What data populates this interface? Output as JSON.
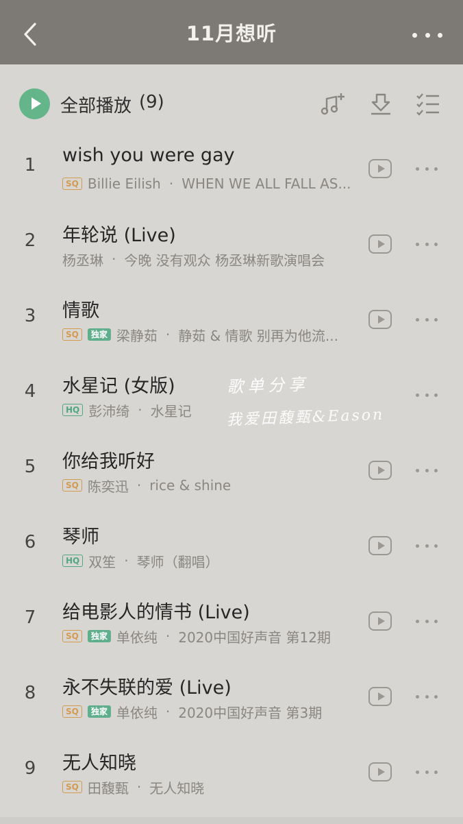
{
  "header": {
    "title": "11月想听"
  },
  "play_all": {
    "label": "全部播放",
    "count": "(9)"
  },
  "songs": [
    {
      "index": "1",
      "title": "wish you were gay",
      "badges": [
        "SQ"
      ],
      "artist": "Billie Eilish",
      "album": "WHEN WE ALL FALL AS...",
      "video": true
    },
    {
      "index": "2",
      "title": "年轮说 (Live)",
      "badges": [],
      "artist": "杨丞琳",
      "album": "今晚 没有观众 杨丞琳新歌演唱会",
      "video": true
    },
    {
      "index": "3",
      "title": "情歌",
      "badges": [
        "SQ",
        "独家"
      ],
      "artist": "梁静茹",
      "album": "静茹 & 情歌 别再为他流...",
      "video": true
    },
    {
      "index": "4",
      "title": "水星记 (女版)",
      "badges": [
        "HQ"
      ],
      "artist": "彭沛绮",
      "album": "水星记",
      "video": false
    },
    {
      "index": "5",
      "title": "你给我听好",
      "badges": [
        "SQ"
      ],
      "artist": "陈奕迅",
      "album": "rice & shine",
      "video": true
    },
    {
      "index": "6",
      "title": "琴师",
      "badges": [
        "HQ"
      ],
      "artist": "双笙",
      "album": "琴师（翻唱）",
      "video": true
    },
    {
      "index": "7",
      "title": "给电影人的情书 (Live)",
      "badges": [
        "SQ",
        "独家"
      ],
      "artist": "单依纯",
      "album": "2020中国好声音 第12期",
      "video": true
    },
    {
      "index": "8",
      "title": "永不失联的爱 (Live)",
      "badges": [
        "SQ",
        "独家"
      ],
      "artist": "单依纯",
      "album": "2020中国好声音 第3期",
      "video": true
    },
    {
      "index": "9",
      "title": "无人知晓",
      "badges": [
        "SQ"
      ],
      "artist": "田馥甄",
      "album": "无人知晓",
      "video": true
    }
  ],
  "watermark": {
    "line1": "歌单分享",
    "line2": "我爱田馥甄&Eason"
  },
  "colors": {
    "header_bg": "#7d7a76",
    "page_bg": "#d8d6d2",
    "accent_green": "#64b58a",
    "sq_orange": "#d49a4f"
  }
}
